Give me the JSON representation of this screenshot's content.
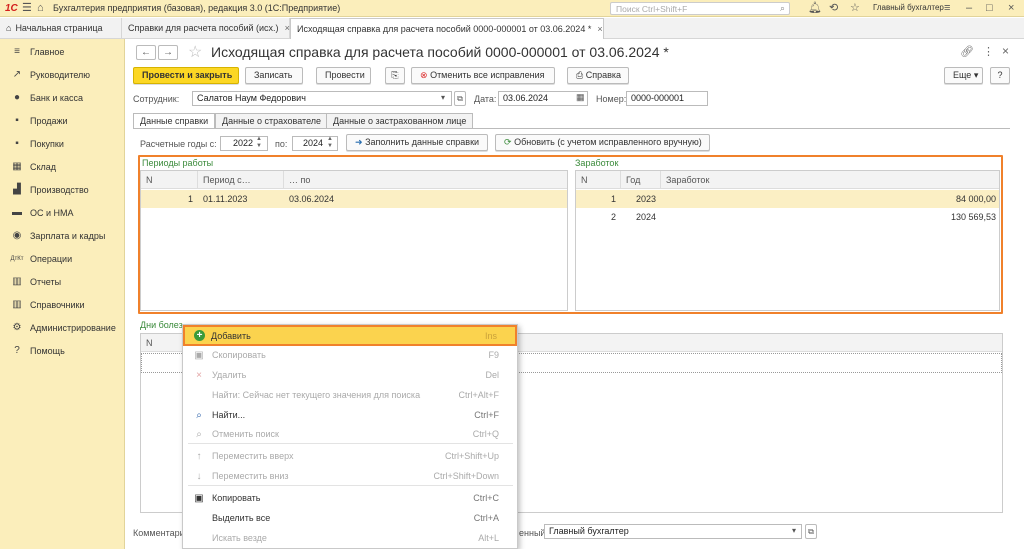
{
  "titlebar": {
    "logo": "1С",
    "title": "Бухгалтерия предприятия (базовая), редакция 3.0  (1С:Предприятие)",
    "search_placeholder": "Поиск Ctrl+Shift+F",
    "user": "Главный бухгалтер"
  },
  "tabs": [
    {
      "label": "Начальная страница"
    },
    {
      "label": "Справки для расчета пособий (исх.)"
    },
    {
      "label": "Исходящая справка для расчета пособий 0000-000001 от 03.06.2024 *"
    }
  ],
  "sidebar": {
    "items": [
      {
        "label": "Главное",
        "icon": "≡"
      },
      {
        "label": "Руководителю",
        "icon": "↗"
      },
      {
        "label": "Банк и касса",
        "icon": "●"
      },
      {
        "label": "Продажи",
        "icon": "▪"
      },
      {
        "label": "Покупки",
        "icon": "▪"
      },
      {
        "label": "Склад",
        "icon": "▦"
      },
      {
        "label": "Производство",
        "icon": "▟"
      },
      {
        "label": "ОС и НМА",
        "icon": "▬"
      },
      {
        "label": "Зарплата и кадры",
        "icon": "◉"
      },
      {
        "label": "Операции",
        "icon": "ДтКт"
      },
      {
        "label": "Отчеты",
        "icon": "▥"
      },
      {
        "label": "Справочники",
        "icon": "▥"
      },
      {
        "label": "Администрирование",
        "icon": "⚙"
      },
      {
        "label": "Помощь",
        "icon": "?"
      }
    ]
  },
  "doc": {
    "title": "Исходящая справка для расчета пособий 0000-000001 от 03.06.2024 *"
  },
  "toolbar": {
    "post_close": "Провести и закрыть",
    "save": "Записать",
    "post": "Провести",
    "cancel_fixes": "Отменить все исправления",
    "certificate": "Справка",
    "more": "Еще",
    "help": "?"
  },
  "form": {
    "employee_label": "Сотрудник:",
    "employee_value": "Салатов Наум Федорович",
    "date_label": "Дата:",
    "date_value": "03.06.2024",
    "number_label": "Номер:",
    "number_value": "0000-000001",
    "comment_label": "Комментари",
    "responsible_label": "енный:",
    "responsible_value": "Главный бухгалтер"
  },
  "form_tabs": [
    {
      "label": "Данные справки"
    },
    {
      "label": "Данные о страхователе"
    },
    {
      "label": "Данные о застрахованном лице"
    }
  ],
  "years": {
    "from_label": "Расчетные годы с:",
    "from_value": "2022",
    "to_label": "по:",
    "to_value": "2024",
    "fill_button": "Заполнить данные справки",
    "refresh_button": "Обновить (с учетом исправленного вручную)"
  },
  "periods": {
    "title": "Периоды работы",
    "headers": [
      "N",
      "Период с…",
      "… по"
    ],
    "rows": [
      [
        "1",
        "01.11.2023",
        "03.06.2024"
      ]
    ]
  },
  "earnings": {
    "title": "Заработок",
    "headers": [
      "N",
      "Год",
      "Заработок"
    ],
    "rows": [
      [
        "1",
        "2023",
        "84 000,00"
      ],
      [
        "2",
        "2024",
        "130 569,53"
      ]
    ]
  },
  "sick": {
    "title": "Дни болез",
    "header_n": "N"
  },
  "menu": {
    "items": [
      {
        "label": "Добавить",
        "shortcut": "Ins",
        "icon": "+",
        "enabled": true,
        "highlight": true
      },
      {
        "label": "Скопировать",
        "shortcut": "F9",
        "icon": "▣",
        "enabled": false
      },
      {
        "label": "Удалить",
        "shortcut": "Del",
        "icon": "×",
        "enabled": false
      },
      {
        "label": "Найти: Сейчас нет текущего значения для поиска",
        "shortcut": "Ctrl+Alt+F",
        "icon": "",
        "enabled": false
      },
      {
        "label": "Найти...",
        "shortcut": "Ctrl+F",
        "icon": "⌕",
        "enabled": true
      },
      {
        "label": "Отменить поиск",
        "shortcut": "Ctrl+Q",
        "icon": "⌕",
        "enabled": false
      },
      {
        "label": "Переместить вверх",
        "shortcut": "Ctrl+Shift+Up",
        "icon": "↑",
        "enabled": false
      },
      {
        "label": "Переместить вниз",
        "shortcut": "Ctrl+Shift+Down",
        "icon": "↓",
        "enabled": false
      },
      {
        "label": "Копировать",
        "shortcut": "Ctrl+C",
        "icon": "▣",
        "enabled": true
      },
      {
        "label": "Выделить все",
        "shortcut": "Ctrl+A",
        "icon": "",
        "enabled": true
      },
      {
        "label": "Искать везде",
        "shortcut": "Alt+L",
        "icon": "",
        "enabled": false
      }
    ]
  }
}
